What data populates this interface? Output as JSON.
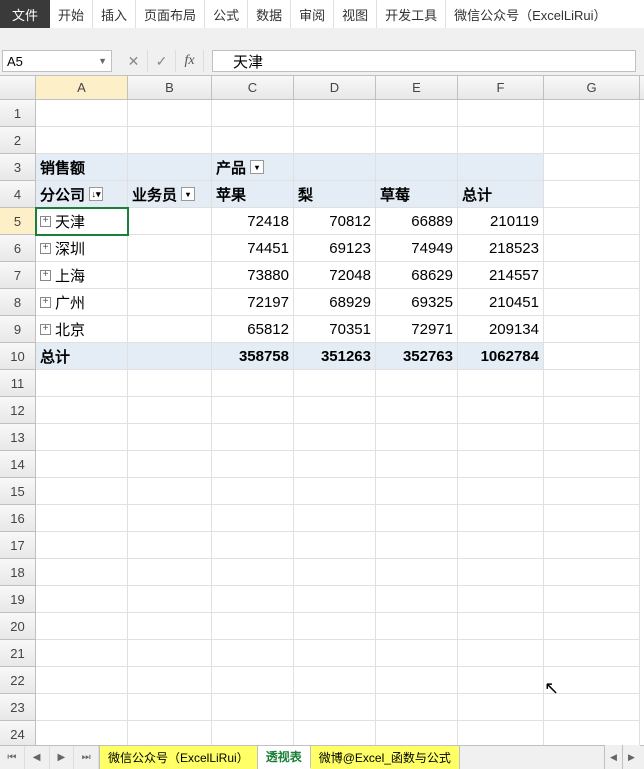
{
  "menu": {
    "file": "文件",
    "items": [
      "开始",
      "插入",
      "页面布局",
      "公式",
      "数据",
      "审阅",
      "视图",
      "开发工具",
      "微信公众号（ExcelLiRui）"
    ]
  },
  "name_box": "A5",
  "formula_value": "天津",
  "columns": [
    "A",
    "B",
    "C",
    "D",
    "E",
    "F",
    "G"
  ],
  "pivot": {
    "corner_label": "销售额",
    "col_field": "产品",
    "row_fields": [
      "分公司",
      "业务员"
    ],
    "col_labels": [
      "苹果",
      "梨",
      "草莓",
      "总计"
    ],
    "rows": [
      {
        "branch": "天津",
        "vals": [
          72418,
          70812,
          66889,
          210119
        ]
      },
      {
        "branch": "深圳",
        "vals": [
          74451,
          69123,
          74949,
          218523
        ]
      },
      {
        "branch": "上海",
        "vals": [
          73880,
          72048,
          68629,
          214557
        ]
      },
      {
        "branch": "广州",
        "vals": [
          72197,
          68929,
          69325,
          210451
        ]
      },
      {
        "branch": "北京",
        "vals": [
          65812,
          70351,
          72971,
          209134
        ]
      }
    ],
    "grand_label": "总计",
    "grand_vals": [
      358758,
      351263,
      352763,
      1062784
    ]
  },
  "sheets": {
    "tabs": [
      {
        "label": "微信公众号（ExcelLiRui）",
        "color": "yellow"
      },
      {
        "label": "透视表",
        "color": "active"
      },
      {
        "label": "微博@Excel_函数与公式",
        "color": "yellow"
      }
    ]
  }
}
